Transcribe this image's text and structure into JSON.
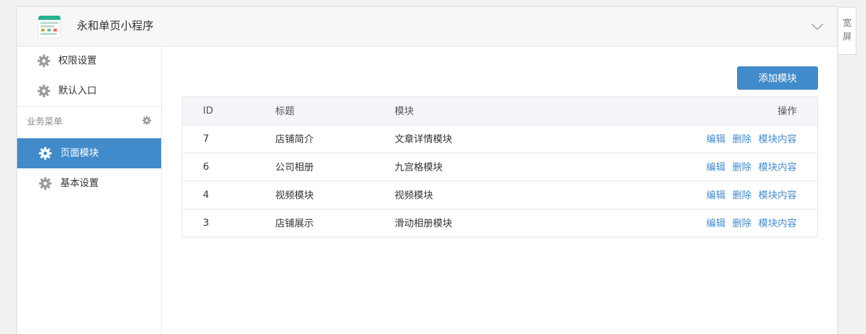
{
  "header": {
    "app_name": "永和单页小程序"
  },
  "sidebar": {
    "top_items": [
      {
        "label": "权限设置",
        "icon": "gear-icon"
      },
      {
        "label": "默认入口",
        "icon": "gear-icon"
      }
    ],
    "section_title": "业务菜单",
    "section_items": [
      {
        "label": "页面模块",
        "icon": "gear-icon",
        "active": true
      },
      {
        "label": "基本设置",
        "icon": "gear-icon",
        "active": false
      }
    ]
  },
  "main": {
    "add_button_label": "添加模块",
    "table": {
      "columns": [
        "ID",
        "标题",
        "模块",
        "操作"
      ],
      "rows": [
        {
          "id": "7",
          "title": "店铺简介",
          "module": "文章详情模块"
        },
        {
          "id": "6",
          "title": "公司相册",
          "module": "九宫格模块"
        },
        {
          "id": "4",
          "title": "视频模块",
          "module": "视频模块"
        },
        {
          "id": "3",
          "title": "店铺展示",
          "module": "滑动相册模块"
        }
      ],
      "actions": [
        "编辑",
        "删除",
        "模块内容"
      ]
    }
  },
  "widescreen_label_1": "宽",
  "widescreen_label_2": "屏",
  "colors": {
    "accent": "#428bca",
    "gear": "#9a9a9a"
  }
}
